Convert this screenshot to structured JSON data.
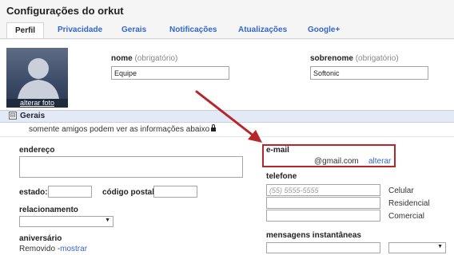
{
  "header": {
    "title": "Configurações do orkut",
    "tabs": [
      {
        "label": "Perfil",
        "active": true
      },
      {
        "label": "Privacidade"
      },
      {
        "label": "Gerais"
      },
      {
        "label": "Notificações"
      },
      {
        "label": "Atualizações"
      },
      {
        "label": "Google+"
      }
    ]
  },
  "profile": {
    "photo_link": "alterar foto",
    "nome_label": "nome",
    "nome_hint": "(obrigatório)",
    "nome_value": "Equipe",
    "sobrenome_label": "sobrenome",
    "sobrenome_hint": "(obrigatório)",
    "sobrenome_value": "Softonic"
  },
  "section": {
    "toggle": "⊟",
    "title": "Gerais",
    "privacy_note": "somente amigos podem ver as informações abaixo"
  },
  "form": {
    "endereco_label": "endereço",
    "estado_label": "estado:",
    "codigo_postal_label": "código postal:",
    "relacionamento_label": "relacionamento",
    "aniversario_label": "aniversário",
    "aniversario_status": "Removido -",
    "aniversario_link": "mostrar"
  },
  "contact": {
    "email_label": "e-mail",
    "email_value": "@gmail.com",
    "email_change": "alterar",
    "telefone_label": "telefone",
    "phone_placeholder": "(55) 5555-5555",
    "phone_types": [
      "Celular",
      "Residencial",
      "Comercial"
    ],
    "im_label": "mensagens instantâneas"
  },
  "colors": {
    "link": "#3366cc",
    "highlight": "#b8262b",
    "section_bg": "#e3eaf5"
  }
}
